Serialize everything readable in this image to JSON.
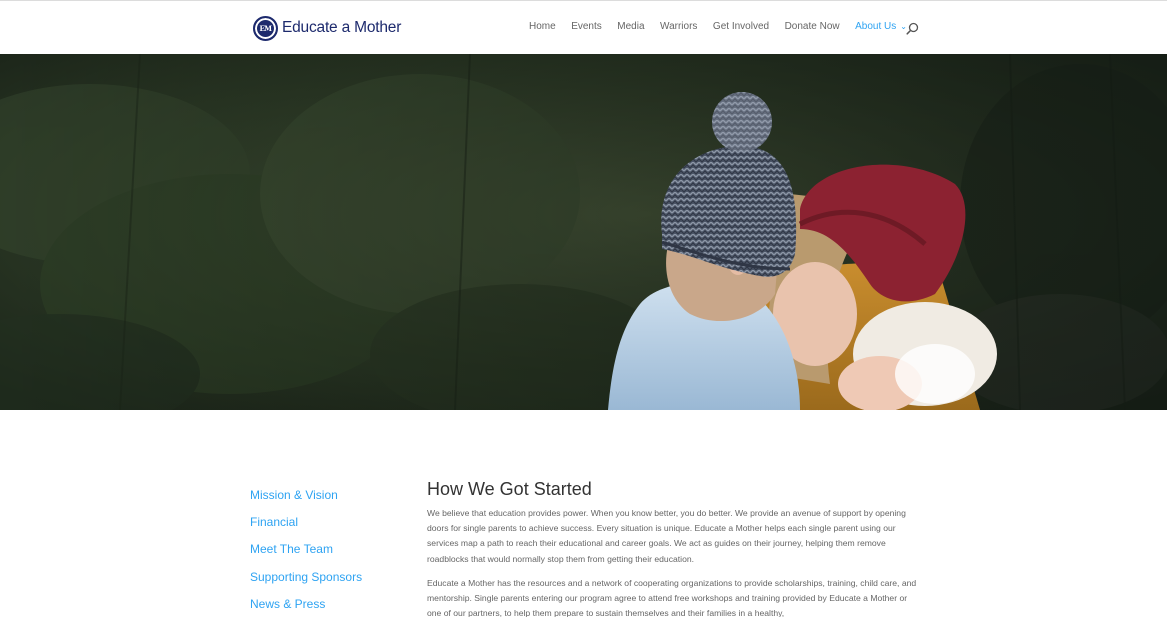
{
  "header": {
    "logo_text": "Educate a Mother",
    "logo_seal_text": "EM",
    "nav": [
      {
        "label": "Home"
      },
      {
        "label": "Events"
      },
      {
        "label": "Media"
      },
      {
        "label": "Warriors"
      },
      {
        "label": "Get Involved"
      },
      {
        "label": "Donate Now"
      },
      {
        "label": "About Us",
        "active": true
      }
    ],
    "search_icon": "search-icon"
  },
  "hero": {
    "image": "mother with toddler in knit hat and infant, forest background"
  },
  "sidebar": {
    "items": [
      {
        "label": "Mission & Vision"
      },
      {
        "label": "Financial"
      },
      {
        "label": "Meet The Team"
      },
      {
        "label": "Supporting Sponsors"
      },
      {
        "label": "News & Press"
      }
    ]
  },
  "main": {
    "title": "How We Got Started",
    "paragraphs": [
      "We believe that education provides power. When you know better, you do better. We provide an avenue of support by opening doors for single parents to achieve success. Every situation is unique. Educate a Mother helps each single parent using our services map a path to reach their educational and career goals. We act as guides on their journey, helping them remove roadblocks that would normally stop them from getting their education.",
      "Educate a Mother has the resources and a network of cooperating organizations to provide scholarships, training, child care, and mentorship. Single parents entering our program agree to attend free workshops and training provided by Educate a Mother or one of our partners, to help them prepare to sustain themselves and their families in a healthy,"
    ]
  },
  "colors": {
    "accent": "#2ea3f2",
    "brand": "#1d2a6d",
    "body_text": "#666666",
    "heading": "#333333"
  }
}
